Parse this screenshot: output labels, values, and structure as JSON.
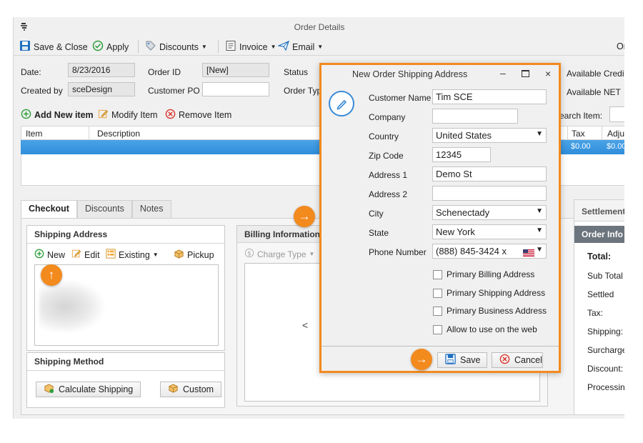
{
  "window": {
    "title": "Order Details",
    "app_icon": "app-icon",
    "right_clip_label": "Or"
  },
  "toolbar": {
    "save_close": "Save & Close",
    "apply": "Apply",
    "discounts": "Discounts",
    "invoice": "Invoice",
    "email": "Email"
  },
  "header": {
    "date_label": "Date:",
    "date_value": "8/23/2016",
    "order_id_label": "Order ID",
    "order_id_value": "[New]",
    "status_label": "Status",
    "created_by_label": "Created by",
    "created_by_value": "sceDesign",
    "customer_po_label": "Customer PO",
    "customer_po_value": "",
    "order_type_label": "Order Typ",
    "available_credits": "Available Credits",
    "available_net": "Available NET"
  },
  "items_toolbar": {
    "add": "Add New item",
    "modify": "Modify Item",
    "remove": "Remove Item",
    "search_label": "earch Item:"
  },
  "grid": {
    "columns": [
      "Item",
      "Description",
      "Tax",
      "Adjus"
    ],
    "row": {
      "tax": "$0.00",
      "adjust": "$0.00"
    }
  },
  "tabs": [
    "Checkout",
    "Discounts",
    "Notes"
  ],
  "shipping_address": {
    "title": "Shipping Address",
    "new": "New",
    "edit": "Edit",
    "existing": "Existing",
    "pickup": "Pickup"
  },
  "shipping_method": {
    "title": "Shipping Method",
    "calculate": "Calculate Shipping",
    "custom": "Custom"
  },
  "billing": {
    "title": "Billing Information",
    "charge_type": "Charge Type",
    "chevron": "<"
  },
  "settlement": {
    "tab": "Settlement",
    "order_info": "Order Info",
    "total": "Total:",
    "rows": [
      "Sub Total",
      "Settled",
      "Tax:",
      "Shipping:",
      "Surcharge:",
      "Discount:",
      "Processing"
    ]
  },
  "dialog": {
    "title": "New Order Shipping Address",
    "fields": {
      "customer_name": {
        "label": "Customer Name",
        "value": "Tim SCE"
      },
      "company": {
        "label": "Company",
        "value": ""
      },
      "country": {
        "label": "Country",
        "value": "United States"
      },
      "zip": {
        "label": "Zip Code",
        "value": "12345"
      },
      "address1": {
        "label": "Address 1",
        "value": "Demo St"
      },
      "address2": {
        "label": "Address 2",
        "value": ""
      },
      "city": {
        "label": "City",
        "value": "Schenectady"
      },
      "state": {
        "label": "State",
        "value": "New York"
      },
      "phone": {
        "label": "Phone Number",
        "value": "(888) 845-3424 x"
      }
    },
    "checkboxes": [
      "Primary Billing Address",
      "Primary Shipping Address",
      "Primary Business Address",
      "Allow to use on the web"
    ],
    "save": "Save",
    "cancel": "Cancel"
  },
  "colors": {
    "accent_orange": "#f28a1e",
    "selection_blue": "#2f8ddb",
    "save_blue": "#1f6fbf",
    "cancel_red": "#d9342b",
    "add_green": "#2e9e3a"
  }
}
